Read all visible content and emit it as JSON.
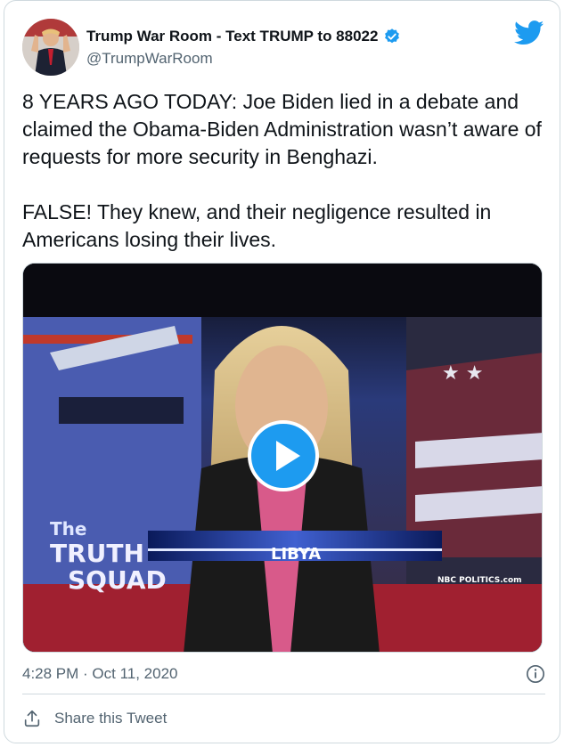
{
  "author": {
    "name": "Trump War Room - Text TRUMP to 88022",
    "handle": "@TrumpWarRoom",
    "verified": true
  },
  "tweet": {
    "text": "8 YEARS AGO TODAY: Joe Biden lied in a debate and claimed the Obama-Biden Administration wasn’t aware of requests for more security in Benghazi.\n\nFALSE! They knew, and their negligence resulted in Americans losing their lives.",
    "timestamp": "4:28 PM · Oct 11, 2020"
  },
  "video": {
    "overlay_title_line1": "The",
    "overlay_title_line2": "TRUTH",
    "overlay_title_line3": "SQUAD",
    "lower_third": "LIBYA",
    "network_bug": "NBC POLITICS.com"
  },
  "actions": {
    "share_label": "Share this Tweet"
  },
  "colors": {
    "accent": "#1d9bf0",
    "text": "#0f1419",
    "secondary": "#536471",
    "border": "#cfd9de"
  },
  "icons": [
    "twitter-bird-icon",
    "verified-badge-icon",
    "info-icon",
    "share-icon",
    "play-icon"
  ]
}
